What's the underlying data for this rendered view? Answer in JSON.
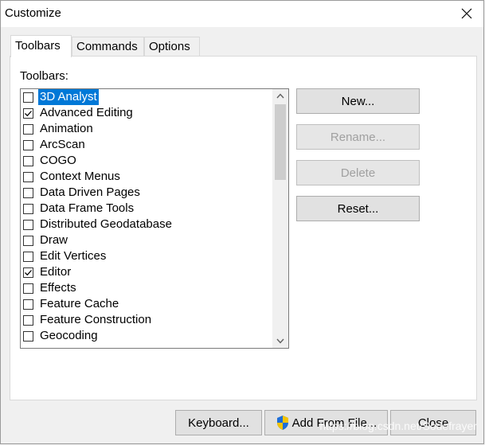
{
  "window": {
    "title": "Customize"
  },
  "tabs": [
    {
      "label": "Toolbars",
      "active": true
    },
    {
      "label": "Commands",
      "active": false
    },
    {
      "label": "Options",
      "active": false
    }
  ],
  "toolbars_panel": {
    "label": "Toolbars:",
    "items": [
      {
        "label": "3D Analyst",
        "checked": false,
        "selected": true
      },
      {
        "label": "Advanced Editing",
        "checked": true,
        "selected": false
      },
      {
        "label": "Animation",
        "checked": false,
        "selected": false
      },
      {
        "label": "ArcScan",
        "checked": false,
        "selected": false
      },
      {
        "label": "COGO",
        "checked": false,
        "selected": false
      },
      {
        "label": "Context Menus",
        "checked": false,
        "selected": false
      },
      {
        "label": "Data Driven Pages",
        "checked": false,
        "selected": false
      },
      {
        "label": "Data Frame Tools",
        "checked": false,
        "selected": false
      },
      {
        "label": "Distributed Geodatabase",
        "checked": false,
        "selected": false
      },
      {
        "label": "Draw",
        "checked": false,
        "selected": false
      },
      {
        "label": "Edit Vertices",
        "checked": false,
        "selected": false
      },
      {
        "label": "Editor",
        "checked": true,
        "selected": false
      },
      {
        "label": "Effects",
        "checked": false,
        "selected": false
      },
      {
        "label": "Feature Cache",
        "checked": false,
        "selected": false
      },
      {
        "label": "Feature Construction",
        "checked": false,
        "selected": false
      },
      {
        "label": "Geocoding",
        "checked": false,
        "selected": false
      }
    ],
    "buttons": {
      "new": "New...",
      "rename": "Rename...",
      "delete": "Delete",
      "reset": "Reset..."
    }
  },
  "footer": {
    "keyboard": "Keyboard...",
    "add_from_file": "Add From File...",
    "close": "Close"
  },
  "watermark": "https://blog.csdn.net/Sodefrayer",
  "colors": {
    "selection": "#0078d7",
    "window_bg": "#f0f0f0",
    "button_bg": "#e1e1e1"
  }
}
